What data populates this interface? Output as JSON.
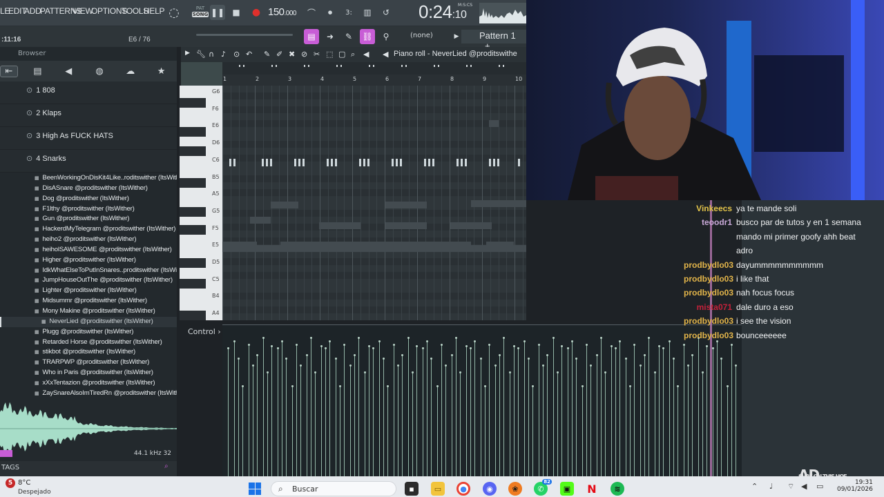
{
  "menubar": {
    "items": [
      "LE",
      "EDIT",
      "ADD",
      "PATTERNS",
      "VIEW",
      "OPTIONS",
      "TOOLS",
      "HELP"
    ],
    "pat_label": "PAT",
    "song_label": "SONG",
    "tempo_main": "150",
    "tempo_frac": ".000",
    "clock_main": "0:24",
    "clock_frac": ":10",
    "clock_unit": "M:S:CS"
  },
  "toolbar2": {
    "time_info": ":11:16",
    "voices": "E6 / 76",
    "pattern_none": "(none)",
    "pattern_name": "Pattern 1",
    "plus": "+"
  },
  "browser": {
    "title": "Browser",
    "tab_icons": [
      "folder-back-icon",
      "file-icon",
      "speaker-icon",
      "globe-icon",
      "cloud-icon",
      "star-icon"
    ],
    "folders": [
      "1 808",
      "2 Klaps",
      "3 High As FUCK HATS",
      "4 Snarks"
    ],
    "files": [
      "BeenWorkingOnDisKit4Like..roditswither (ItsWither)",
      "DisASnare @proditswither (ItsWither)",
      "Dog @proditswither (ItsWither)",
      "F1lthy @proditswither (ItsWither)",
      "Gun @proditswither (ItsWither)",
      "HackerdMyTelegram @proditswither (ItsWither)",
      "heiho2 @proditswither (ItsWither)",
      "heiholSAWESOME @proditswither (ItsWither)",
      "Higher @proditswither (ItsWither)",
      "IdkWhatElseToPutInSnares..proditswither (ItsWither)",
      "JumpHouseOutThe @proditswither (ItsWither)",
      "Lighter @proditswither (ItsWither)",
      "Midsummr @proditswither (ItsWither)",
      "Mony Makine @proditswither (ItsWither)",
      "NeverLied @proditswither (ItsWither)",
      "Plugg @proditswither (ItsWither)",
      "Retarded Horse @proditswither (ItsWither)",
      "stikbot @proditswither (ItsWither)",
      "TRARPWP @proditswither (ItsWither)",
      "Who in Paris @proditswither (ItsWither)",
      "xXxTentazion @proditswither (ItsWither)",
      "ZaySnareAlsoImTiredRn @proditswither (ItsWither)"
    ],
    "selected_index": 14,
    "sample_rate": "44.1 kHz",
    "bit_depth": "32",
    "tags_label": "TAGS"
  },
  "piano_roll": {
    "title": "Piano roll - NeverLied @proditswithe",
    "bar_numbers": [
      "1",
      "2",
      "3",
      "4",
      "5",
      "6",
      "7",
      "8",
      "9",
      "10"
    ],
    "key_labels": [
      "G6",
      "F6",
      "E6",
      "D6",
      "C6",
      "B5",
      "A5",
      "G5",
      "F5",
      "E5",
      "D5",
      "C5",
      "B4",
      "A4"
    ],
    "control_label": "Control"
  },
  "chat": {
    "messages": [
      {
        "user": "Vinkeecs",
        "color": "#e3c44a",
        "text": "ya te mande soli"
      },
      {
        "user": "teoodr1",
        "color": "#c9a9d8",
        "text": "busco par de tutos y en 1 semana mando mi primer goofy ahh beat adro"
      },
      {
        "user": "prodbydlo03",
        "color": "#e3b54a",
        "text": "dayummmmmmmmmm"
      },
      {
        "user": "prodbydlo03",
        "color": "#e3b54a",
        "text": "i like that"
      },
      {
        "user": "prodbydlo03",
        "color": "#e3b54a",
        "text": "nah focus focus"
      },
      {
        "user": "mista071",
        "color": "#c4213a",
        "text": "dale duro a eso"
      },
      {
        "user": "prodbydlo03",
        "color": "#e3b54a",
        "text": "i see the vision"
      },
      {
        "user": "prodbydlo03",
        "color": "#e3b54a",
        "text": "bounceeeeee"
      }
    ]
  },
  "watermark": {
    "big": "AD",
    "small": "SURE ON THIS HOE"
  },
  "taskbar": {
    "weather_badge": "5",
    "weather_temp": "8°C",
    "weather_desc": "Despejado",
    "search_label": "Buscar",
    "whatsapp_badge": "82",
    "time": "19:31",
    "date": "09/01/2026"
  },
  "colors": {
    "accent_pink": "#c85dd6",
    "note": "#cfd8dc",
    "velocity": "#94b7a8"
  }
}
